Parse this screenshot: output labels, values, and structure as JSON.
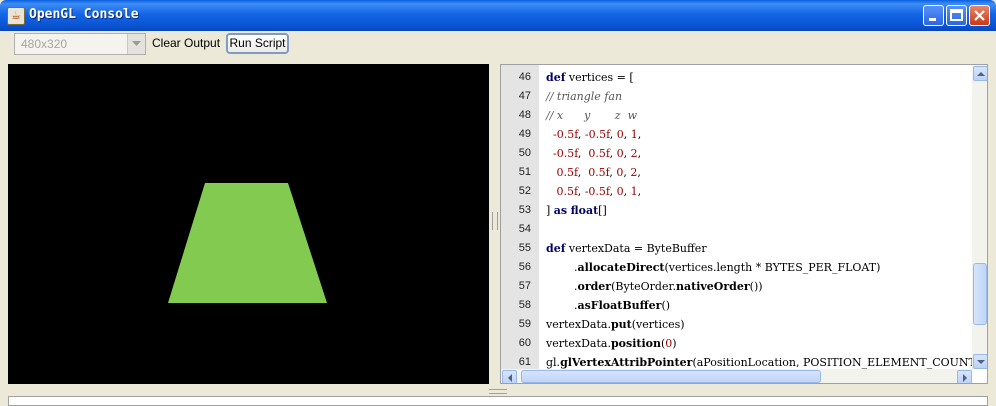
{
  "window": {
    "title": "OpenGL Console",
    "app_icon": "java-cup-icon"
  },
  "toolbar": {
    "resolution_value": "480x320",
    "clear_label": "Clear Output",
    "run_label": "Run Script"
  },
  "colors": {
    "shape_fill": "#82cb50",
    "canvas_bg": "#000000",
    "keyword": "#000066",
    "number": "#990000"
  },
  "editor": {
    "lines": [
      {
        "n": "46",
        "t": "def vertices = ["
      },
      {
        "n": "47",
        "t": "// triangle fan"
      },
      {
        "n": "48",
        "t": "// x      y       z  w"
      },
      {
        "n": "49",
        "t": "  -0.5f, -0.5f, 0, 1,"
      },
      {
        "n": "50",
        "t": "  -0.5f,  0.5f, 0, 2,"
      },
      {
        "n": "51",
        "t": "   0.5f,  0.5f, 0, 2,"
      },
      {
        "n": "52",
        "t": "   0.5f, -0.5f, 0, 1,"
      },
      {
        "n": "53",
        "t": "] as float[]"
      },
      {
        "n": "54",
        "t": ""
      },
      {
        "n": "55",
        "t": "def vertexData = ByteBuffer"
      },
      {
        "n": "56",
        "t": "        .allocateDirect(vertices.length * BYTES_PER_FLOAT)"
      },
      {
        "n": "57",
        "t": "        .order(ByteOrder.nativeOrder())"
      },
      {
        "n": "58",
        "t": "        .asFloatBuffer()"
      },
      {
        "n": "59",
        "t": "vertexData.put(vertices)"
      },
      {
        "n": "60",
        "t": "vertexData.position(0)"
      },
      {
        "n": "61",
        "t": "gl.glVertexAttribPointer(aPositionLocation, POSITION_ELEMENT_COUNT,"
      }
    ]
  }
}
